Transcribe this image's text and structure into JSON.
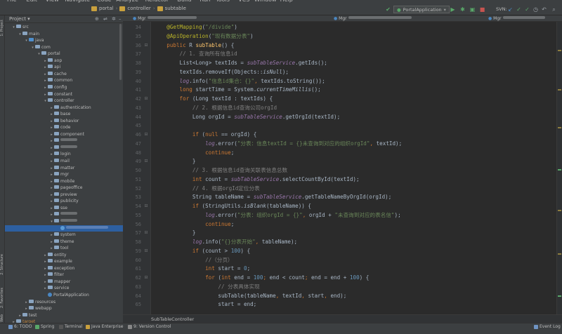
{
  "menu": {
    "items": [
      "File",
      "Edit",
      "View",
      "Navigate",
      "Code",
      "Analyze",
      "Refactor",
      "Build",
      "Run",
      "Tools",
      "VCS",
      "Window",
      "Help"
    ]
  },
  "toolbar": {
    "breadcrumb": [
      "portal",
      "controller",
      "subtable"
    ],
    "run_config": "PortalApplication",
    "svn_label": "SVN:"
  },
  "left_strip": {
    "tabs": [
      "1: Project",
      "2: Structure",
      "2: Favorites",
      "Web"
    ]
  },
  "project": {
    "title": "Project",
    "tree": [
      {
        "label": "src",
        "depth": 1,
        "open": true,
        "kind": "folder"
      },
      {
        "label": "main",
        "depth": 2,
        "open": true,
        "kind": "folder"
      },
      {
        "label": "java",
        "depth": 3,
        "open": true,
        "kind": "src"
      },
      {
        "label": "com",
        "depth": 4,
        "open": true,
        "kind": "folder"
      },
      {
        "label": "portal",
        "depth": 5,
        "open": true,
        "kind": "folder"
      },
      {
        "label": "aop",
        "depth": 6,
        "open": false,
        "kind": "folder"
      },
      {
        "label": "api",
        "depth": 6,
        "open": false,
        "kind": "folder"
      },
      {
        "label": "cache",
        "depth": 6,
        "open": false,
        "kind": "folder"
      },
      {
        "label": "common",
        "depth": 6,
        "open": false,
        "kind": "folder"
      },
      {
        "label": "config",
        "depth": 6,
        "open": false,
        "kind": "folder"
      },
      {
        "label": "constant",
        "depth": 6,
        "open": false,
        "kind": "folder"
      },
      {
        "label": "controller",
        "depth": 6,
        "open": true,
        "kind": "folder"
      },
      {
        "label": "authentication",
        "depth": 7,
        "open": false,
        "kind": "folder"
      },
      {
        "label": "base",
        "depth": 7,
        "open": false,
        "kind": "folder"
      },
      {
        "label": "behavior",
        "depth": 7,
        "open": false,
        "kind": "folder"
      },
      {
        "label": "code",
        "depth": 7,
        "open": false,
        "kind": "folder"
      },
      {
        "label": "component",
        "depth": 7,
        "open": false,
        "kind": "folder"
      },
      {
        "label": "",
        "depth": 7,
        "open": false,
        "kind": "blurred"
      },
      {
        "label": "",
        "depth": 7,
        "open": false,
        "kind": "blurred"
      },
      {
        "label": "login",
        "depth": 7,
        "open": false,
        "kind": "folder"
      },
      {
        "label": "mail",
        "depth": 7,
        "open": false,
        "kind": "folder"
      },
      {
        "label": "matter",
        "depth": 7,
        "open": false,
        "kind": "folder"
      },
      {
        "label": "mgr",
        "depth": 7,
        "open": false,
        "kind": "folder"
      },
      {
        "label": "mobile",
        "depth": 7,
        "open": false,
        "kind": "folder"
      },
      {
        "label": "pageoffice",
        "depth": 7,
        "open": false,
        "kind": "folder"
      },
      {
        "label": "preview",
        "depth": 7,
        "open": false,
        "kind": "folder"
      },
      {
        "label": "publicity",
        "depth": 7,
        "open": false,
        "kind": "folder"
      },
      {
        "label": "sse",
        "depth": 7,
        "open": false,
        "kind": "folder"
      },
      {
        "label": "",
        "depth": 7,
        "open": false,
        "kind": "blurred"
      },
      {
        "label": "",
        "depth": 7,
        "open": true,
        "kind": "blurred"
      },
      {
        "label": "",
        "depth": 8,
        "open": false,
        "kind": "selected"
      },
      {
        "label": "system",
        "depth": 7,
        "open": false,
        "kind": "folder"
      },
      {
        "label": "theme",
        "depth": 7,
        "open": false,
        "kind": "folder"
      },
      {
        "label": "tool",
        "depth": 7,
        "open": false,
        "kind": "folder"
      },
      {
        "label": "entity",
        "depth": 6,
        "open": false,
        "kind": "folder"
      },
      {
        "label": "example",
        "depth": 6,
        "open": false,
        "kind": "folder"
      },
      {
        "label": "exception",
        "depth": 6,
        "open": false,
        "kind": "folder"
      },
      {
        "label": "filter",
        "depth": 6,
        "open": false,
        "kind": "folder"
      },
      {
        "label": "mapper",
        "depth": 6,
        "open": false,
        "kind": "folder"
      },
      {
        "label": "service",
        "depth": 6,
        "open": false,
        "kind": "folder"
      },
      {
        "label": "PortalApplication",
        "depth": 6,
        "open": false,
        "kind": "class"
      },
      {
        "label": "resources",
        "depth": 3,
        "open": false,
        "kind": "folder"
      },
      {
        "label": "webapp",
        "depth": 3,
        "open": false,
        "kind": "folder"
      },
      {
        "label": "test",
        "depth": 2,
        "open": false,
        "kind": "folder"
      },
      {
        "label": "target",
        "depth": 1,
        "open": false,
        "kind": "folder"
      }
    ]
  },
  "editor": {
    "tabs": [
      "Mgr",
      "Mgr",
      "Mgr"
    ],
    "file_breadcrumb": "SubTableController",
    "lines": [
      {
        "n": 34,
        "indent": 4,
        "tokens": [
          [
            "a",
            "@GetMapping"
          ],
          [
            "t",
            "("
          ],
          [
            "s",
            "\"/divide\""
          ],
          [
            "t",
            ")"
          ]
        ]
      },
      {
        "n": 35,
        "indent": 4,
        "tokens": [
          [
            "a",
            "@ApiOperation"
          ],
          [
            "t",
            "("
          ],
          [
            "s",
            "\"现有数据分表\""
          ],
          [
            "t",
            ")"
          ]
        ]
      },
      {
        "n": 36,
        "indent": 4,
        "tokens": [
          [
            "k",
            "public "
          ],
          [
            "t",
            "R "
          ],
          [
            "f",
            "subTable"
          ],
          [
            "t",
            "() {"
          ]
        ]
      },
      {
        "n": 37,
        "indent": 8,
        "tokens": [
          [
            "c",
            "// 1. 查询所有信息id"
          ]
        ]
      },
      {
        "n": 38,
        "indent": 8,
        "tokens": [
          [
            "t",
            "List<Long> textIds = "
          ],
          [
            "p",
            "subTableService"
          ],
          [
            "t",
            ".getIds();"
          ]
        ]
      },
      {
        "n": 39,
        "indent": 8,
        "tokens": [
          [
            "t",
            "textIds.removeIf(Objects::"
          ],
          [
            "sm",
            "isNull"
          ],
          [
            "t",
            ");"
          ]
        ]
      },
      {
        "n": 40,
        "indent": 8,
        "tokens": [
          [
            "p",
            "log"
          ],
          [
            "t",
            ".info("
          ],
          [
            "s",
            "\"信息id集合：{}\""
          ],
          [
            "k",
            ", "
          ],
          [
            "t",
            "textIds.toString());"
          ]
        ]
      },
      {
        "n": 41,
        "indent": 8,
        "tokens": [
          [
            "k",
            "long "
          ],
          [
            "t",
            "startTime = System."
          ],
          [
            "sm",
            "currentTimeMillis"
          ],
          [
            "t",
            "();"
          ]
        ]
      },
      {
        "n": 42,
        "indent": 8,
        "tokens": [
          [
            "k",
            "for "
          ],
          [
            "t",
            "("
          ],
          [
            "t",
            "Long textId : textIds) {"
          ]
        ]
      },
      {
        "n": 43,
        "indent": 12,
        "tokens": [
          [
            "c",
            "// 2. 根据信息id查询公司orgId"
          ]
        ]
      },
      {
        "n": 44,
        "indent": 12,
        "tokens": [
          [
            "t",
            "Long orgId = "
          ],
          [
            "p",
            "subTableService"
          ],
          [
            "t",
            ".getOrgId(textId);"
          ]
        ]
      },
      {
        "n": 45,
        "indent": 0,
        "tokens": []
      },
      {
        "n": 46,
        "indent": 12,
        "tokens": [
          [
            "k",
            "if "
          ],
          [
            "t",
            "("
          ],
          [
            "k",
            "null "
          ],
          [
            "t",
            "== orgId) {"
          ]
        ]
      },
      {
        "n": 47,
        "indent": 16,
        "tokens": [
          [
            "p",
            "log"
          ],
          [
            "t",
            ".error("
          ],
          [
            "s",
            "\"分表：信息textId = {}未查询到对应的组织orgId\""
          ],
          [
            "k",
            ", "
          ],
          [
            "t",
            "textId);"
          ]
        ]
      },
      {
        "n": 48,
        "indent": 16,
        "tokens": [
          [
            "k",
            "continue"
          ],
          [
            "t",
            ";"
          ]
        ]
      },
      {
        "n": 49,
        "indent": 12,
        "tokens": [
          [
            "t",
            "}"
          ]
        ]
      },
      {
        "n": 50,
        "indent": 12,
        "tokens": [
          [
            "c",
            "// 3. 根据信息id查询关联表信息总数"
          ]
        ]
      },
      {
        "n": 51,
        "indent": 12,
        "tokens": [
          [
            "k",
            "int "
          ],
          [
            "t",
            "count = "
          ],
          [
            "p",
            "subTableService"
          ],
          [
            "t",
            ".selectCountById(textId);"
          ]
        ]
      },
      {
        "n": 52,
        "indent": 12,
        "tokens": [
          [
            "c",
            "// 4. 根据orgId定位分表"
          ]
        ]
      },
      {
        "n": 53,
        "indent": 12,
        "tokens": [
          [
            "t",
            "String tableName = "
          ],
          [
            "p",
            "subTableService"
          ],
          [
            "t",
            ".getTableNameByOrgId(orgId);"
          ]
        ]
      },
      {
        "n": 54,
        "indent": 12,
        "tokens": [
          [
            "k",
            "if "
          ],
          [
            "t",
            "(StringUtils."
          ],
          [
            "sm",
            "isBlank"
          ],
          [
            "t",
            "(tableName)) {"
          ]
        ]
      },
      {
        "n": 55,
        "indent": 16,
        "tokens": [
          [
            "p",
            "log"
          ],
          [
            "t",
            ".error("
          ],
          [
            "s",
            "\"分表：组织orgId = {}\""
          ],
          [
            "k",
            ", "
          ],
          [
            "t",
            "orgId + "
          ],
          [
            "s",
            "\"未查询到对应的表名信\""
          ],
          [
            "t",
            ");"
          ]
        ]
      },
      {
        "n": 56,
        "indent": 16,
        "tokens": [
          [
            "k",
            "continue"
          ],
          [
            "t",
            ";"
          ]
        ]
      },
      {
        "n": 57,
        "indent": 12,
        "tokens": [
          [
            "t",
            "}"
          ]
        ]
      },
      {
        "n": 58,
        "indent": 12,
        "tokens": [
          [
            "p",
            "log"
          ],
          [
            "t",
            ".info("
          ],
          [
            "s",
            "\"{}分表开始\""
          ],
          [
            "k",
            ", "
          ],
          [
            "t",
            "tableName);"
          ]
        ]
      },
      {
        "n": 59,
        "indent": 12,
        "tokens": [
          [
            "k",
            "if "
          ],
          [
            "t",
            "(count > "
          ],
          [
            "n",
            "100"
          ],
          [
            "t",
            ") {"
          ]
        ]
      },
      {
        "n": 60,
        "indent": 16,
        "tokens": [
          [
            "c",
            "//（分页）"
          ]
        ]
      },
      {
        "n": 61,
        "indent": 16,
        "tokens": [
          [
            "k",
            "int "
          ],
          [
            "t",
            "start = "
          ],
          [
            "n",
            "0"
          ],
          [
            "t",
            ";"
          ]
        ]
      },
      {
        "n": 62,
        "indent": 16,
        "tokens": [
          [
            "k",
            "for "
          ],
          [
            "t",
            "("
          ],
          [
            "k",
            "int "
          ],
          [
            "t",
            "end = "
          ],
          [
            "n",
            "100"
          ],
          [
            "k",
            "; "
          ],
          [
            "t",
            "end < count"
          ],
          [
            "k",
            "; "
          ],
          [
            "t",
            "end = end + "
          ],
          [
            "n",
            "100"
          ],
          [
            "t",
            ") {"
          ]
        ]
      },
      {
        "n": 63,
        "indent": 20,
        "tokens": [
          [
            "c",
            "// 分表具体实现"
          ]
        ]
      },
      {
        "n": 64,
        "indent": 20,
        "tokens": [
          [
            "t",
            "subTable(tableName"
          ],
          [
            "k",
            ", "
          ],
          [
            "t",
            "textId"
          ],
          [
            "k",
            ", "
          ],
          [
            "t",
            "start"
          ],
          [
            "k",
            ", "
          ],
          [
            "t",
            "end);"
          ]
        ]
      },
      {
        "n": 65,
        "indent": 20,
        "tokens": [
          [
            "t",
            "start = end;"
          ]
        ]
      }
    ]
  },
  "bottom": {
    "tabs": [
      "6: TODO",
      "Spring",
      "Terminal",
      "Java Enterprise",
      "9: Version Control"
    ],
    "event_log": "Event Log"
  },
  "colors": {
    "bg": "#2b2b2b",
    "panel": "#3c3f41",
    "selection": "#2d5fa0",
    "run_green": "#59a869",
    "stop_red": "#c75450"
  }
}
